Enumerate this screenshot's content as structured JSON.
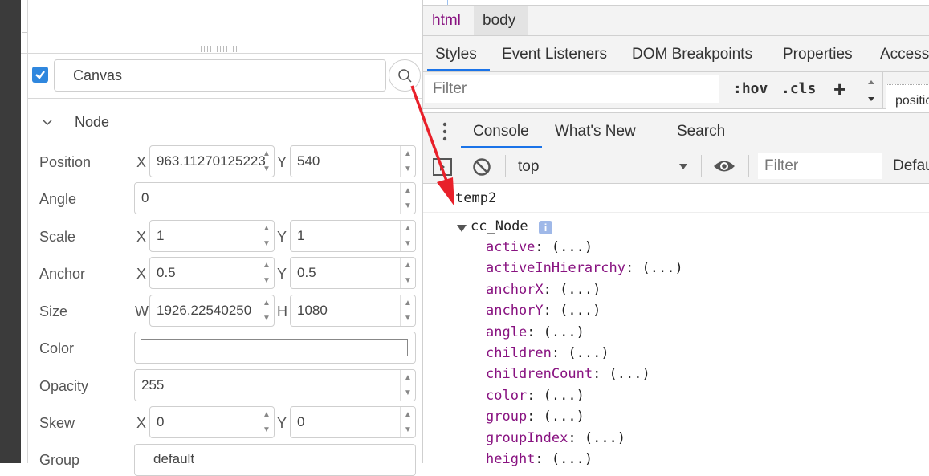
{
  "inspector": {
    "checkbox_checked": true,
    "node_name": "Canvas",
    "section_label": "Node",
    "properties": {
      "position": {
        "label": "Position",
        "x_axis": "X",
        "x": "963.11270125223",
        "y_axis": "Y",
        "y": "540"
      },
      "angle": {
        "label": "Angle",
        "value": "0"
      },
      "scale": {
        "label": "Scale",
        "x_axis": "X",
        "x": "1",
        "y_axis": "Y",
        "y": "1"
      },
      "anchor": {
        "label": "Anchor",
        "x_axis": "X",
        "x": "0.5",
        "y_axis": "Y",
        "y": "0.5"
      },
      "size": {
        "label": "Size",
        "w_axis": "W",
        "w": "1926.22540250",
        "h_axis": "H",
        "h": "1080"
      },
      "color": {
        "label": "Color",
        "value": "#ffffff"
      },
      "opacity": {
        "label": "Opacity",
        "value": "255"
      },
      "skew": {
        "label": "Skew",
        "x_axis": "X",
        "x": "0",
        "y_axis": "Y",
        "y": "0"
      },
      "group": {
        "label": "Group",
        "value": "default"
      }
    },
    "spin_up": "▲",
    "spin_down": "▼"
  },
  "devtools": {
    "breadcrumb": [
      "html",
      "body"
    ],
    "style_tabs": [
      "Styles",
      "Event Listeners",
      "DOM Breakpoints",
      "Properties",
      "Accessi"
    ],
    "filter_placeholder": "Filter",
    "hov": ":hov",
    "cls": ".cls",
    "plus": "+",
    "position_snip": "positio",
    "drawer_tabs": [
      "Console",
      "What's New",
      "Search"
    ],
    "context": "top",
    "console_filter_placeholder": "Filter",
    "levels": "Defau",
    "console": {
      "expression": "temp2",
      "object_name": "cc_Node",
      "info_badge": "i",
      "props": [
        {
          "key": "active",
          "value": "(...)"
        },
        {
          "key": "activeInHierarchy",
          "value": "(...)"
        },
        {
          "key": "anchorX",
          "value": "(...)"
        },
        {
          "key": "anchorY",
          "value": "(...)"
        },
        {
          "key": "angle",
          "value": "(...)"
        },
        {
          "key": "children",
          "value": "(...)"
        },
        {
          "key": "childrenCount",
          "value": "(...)"
        },
        {
          "key": "color",
          "value": "(...)"
        },
        {
          "key": "group",
          "value": "(...)"
        },
        {
          "key": "groupIndex",
          "value": "(...)"
        },
        {
          "key": "height",
          "value": "(...)"
        }
      ]
    }
  },
  "colors": {
    "checkbox": "#2f87de",
    "active_tab_underline": "#1a73e8",
    "console_key": "#881280",
    "arrow": "#e8202a"
  }
}
